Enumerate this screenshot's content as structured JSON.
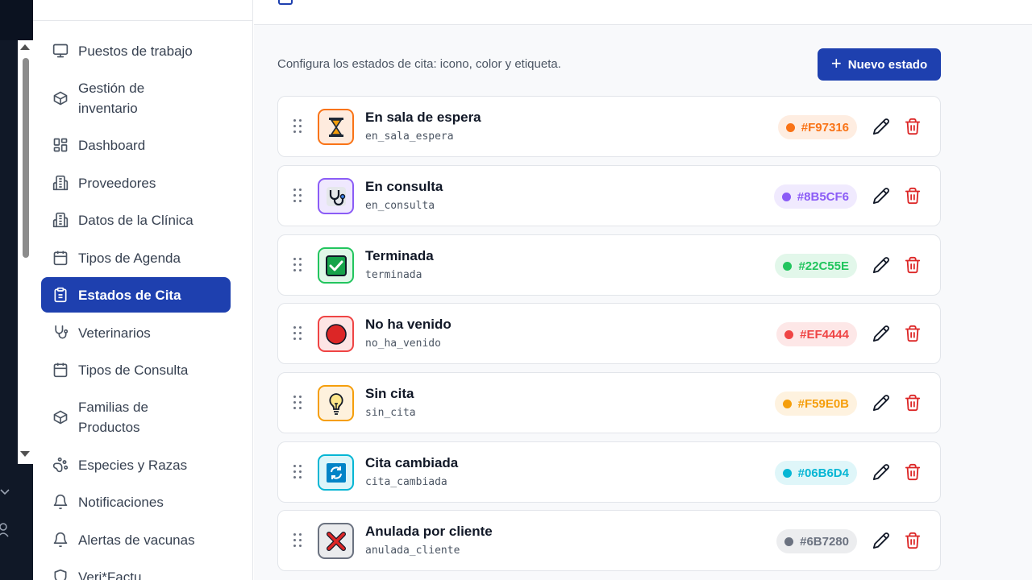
{
  "sidebar": {
    "items": [
      {
        "label": "Puestos de trabajo",
        "icon": "monitor-icon"
      },
      {
        "label": "Gestión de\ninventario",
        "icon": "box-icon"
      },
      {
        "label": "Dashboard",
        "icon": "dashboard-icon"
      },
      {
        "label": "Proveedores",
        "icon": "building-icon"
      },
      {
        "label": "Datos de la Clínica",
        "icon": "building-icon"
      },
      {
        "label": "Tipos de Agenda",
        "icon": "calendar-icon"
      },
      {
        "label": "Estados de Cita",
        "icon": "clipboard-icon",
        "active": true
      },
      {
        "label": "Veterinarios",
        "icon": "stethoscope-icon"
      },
      {
        "label": "Tipos de Consulta",
        "icon": "calendar-icon"
      },
      {
        "label": "Familias de\nProductos",
        "icon": "box-icon"
      },
      {
        "label": "Especies y Razas",
        "icon": "paw-icon"
      },
      {
        "label": "Notificaciones",
        "icon": "bell-icon"
      },
      {
        "label": "Alertas de vacunas",
        "icon": "bell-icon"
      },
      {
        "label": "Veri*Factu",
        "icon": "shield-icon"
      }
    ]
  },
  "main": {
    "description": "Configura los estados de cita: icono, color y etiqueta.",
    "new_button_label": "Nuevo estado",
    "states": [
      {
        "name": "En sala de espera",
        "key": "en_sala_espera",
        "color": "#F97316",
        "icon": "hourglass-icon"
      },
      {
        "name": "En consulta",
        "key": "en_consulta",
        "color": "#8B5CF6",
        "icon": "stethoscope-icon"
      },
      {
        "name": "Terminada",
        "key": "terminada",
        "color": "#22C55E",
        "icon": "check-box-icon"
      },
      {
        "name": "No ha venido",
        "key": "no_ha_venido",
        "color": "#EF4444",
        "icon": "red-circle-icon"
      },
      {
        "name": "Sin cita",
        "key": "sin_cita",
        "color": "#F59E0B",
        "icon": "lightbulb-icon"
      },
      {
        "name": "Cita cambiada",
        "key": "cita_cambiada",
        "color": "#06B6D4",
        "icon": "refresh-icon"
      },
      {
        "name": "Anulada por cliente",
        "key": "anulada_cliente",
        "color": "#6B7280",
        "icon": "cross-mark-icon"
      }
    ]
  }
}
